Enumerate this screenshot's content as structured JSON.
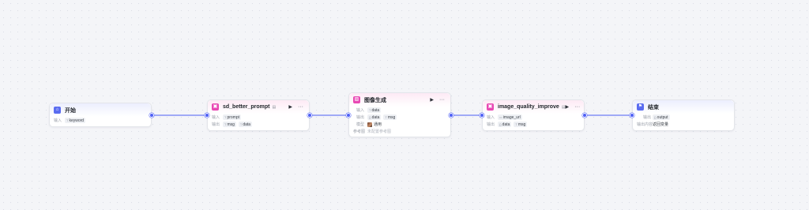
{
  "canvas": {
    "edge_color": "#4d5ff5",
    "background": "#f4f5f8"
  },
  "nodes": [
    {
      "id": "start",
      "title": "开始",
      "icon": "home-icon",
      "accent": "#5a6cf0",
      "rows": [
        {
          "label": "输入",
          "tags": [
            {
              "type_icon": "str",
              "text": "keyword"
            }
          ]
        }
      ]
    },
    {
      "id": "sd_better_prompt",
      "title": "sd_better_prompt",
      "icon": "plugin-icon",
      "accent": "#e848b4",
      "rows": [
        {
          "label": "输入",
          "tags": [
            {
              "type_icon": "str",
              "text": "prompt"
            }
          ]
        },
        {
          "label": "输出",
          "tags": [
            {
              "type_icon": "str",
              "text": "msg"
            },
            {
              "type_icon": "str",
              "text": "data"
            }
          ]
        }
      ]
    },
    {
      "id": "image_gen",
      "title": "图像生成",
      "icon": "image-icon",
      "accent": "#e848b4",
      "rows": [
        {
          "label": "输入",
          "tags": [
            {
              "type_icon": "str",
              "text": "data"
            }
          ]
        },
        {
          "label": "输出",
          "tags": [
            {
              "type_icon": "{}",
              "text": "data"
            },
            {
              "type_icon": "str",
              "text": "msg"
            }
          ]
        },
        {
          "label": "模型",
          "model": "通用"
        },
        {
          "label": "参考图",
          "placeholder": "未配置参考图"
        }
      ]
    },
    {
      "id": "image_quality_improve",
      "title": "image_quality_improve",
      "icon": "plugin-icon",
      "accent": "#e848b4",
      "rows": [
        {
          "label": "输入",
          "tags": [
            {
              "type_icon": "img",
              "text": "image_url"
            }
          ]
        },
        {
          "label": "输出",
          "tags": [
            {
              "type_icon": "{}",
              "text": "data"
            },
            {
              "type_icon": "str",
              "text": "msg"
            }
          ]
        }
      ]
    },
    {
      "id": "end",
      "title": "结束",
      "icon": "flag-icon",
      "accent": "#5a6cf0",
      "rows": [
        {
          "label": "输出",
          "tags": [
            {
              "type_icon": "{}",
              "text": "output"
            }
          ]
        },
        {
          "label": "输出内容",
          "text": "返回变量"
        }
      ]
    }
  ]
}
